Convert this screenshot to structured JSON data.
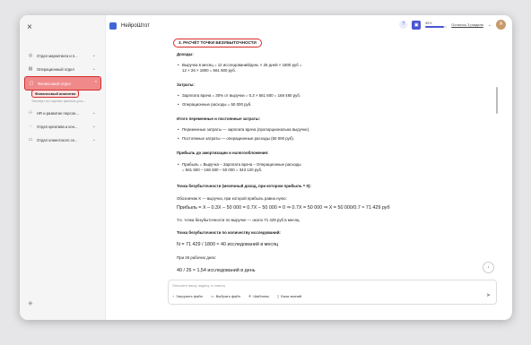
{
  "sidebar": {
    "close": "×",
    "items": [
      {
        "icon": "◎",
        "label": "Отдел маркетинга и п...",
        "chevron": "⌄"
      },
      {
        "icon": "▤",
        "label": "Операционный отдел",
        "chevron": "⌄"
      },
      {
        "icon": "▢",
        "label": "Финансовый отдел",
        "chevron": "^"
      },
      {
        "icon": "⚇",
        "label": "HR и развитие персон...",
        "chevron": "⌄"
      },
      {
        "icon": "◌",
        "label": "Отдел креатива и кон...",
        "chevron": "⌄"
      },
      {
        "icon": "▭",
        "label": "Отдел клиентского се...",
        "chevron": "⌄"
      }
    ],
    "sub_selected": "Финансовый аналитик",
    "sub_dim": "Эксперт по оценке финанс-рис...",
    "bottom_icon": "✳"
  },
  "topbar": {
    "app_name": "НейроШтот",
    "help_icon": "?",
    "square_icon": "▣",
    "percent": "85%",
    "usage_fill": 0.85,
    "remaining": "Осталось 3 раздела",
    "chevron": "⌄",
    "avatar_initial": "A"
  },
  "content": {
    "section_title": "3. РАСЧЁТ ТОЧКИ БЕЗУБЫТОЧНОСТИ",
    "income_h": "Доходы:",
    "income_li1": "Выручка в месяц = 12 исследований/день × 26 дней × 1800 руб =",
    "income_li1b": "12 × 26 × 1800 = 561 600 руб.",
    "costs_h": "Затраты:",
    "costs_li1": "Зарплата врача = 30% от выручки = 0,3 × 561 600 = 168 480 руб.",
    "costs_li2": "Операционные расходы = 50 000 руб.",
    "varfix_h": "Итого переменные и постоянные затраты:",
    "varfix_li1": "Переменные затраты — зарплата врача (пропорциональна выручке).",
    "varfix_li2": "Постоянные затраты — операционные расходы (50 000 руб).",
    "profit_h": "Прибыль до амортизации и налогообложения:",
    "profit_li1": "Прибыль = Выручка – Зарплата врача – Операционные расходы",
    "profit_li1b": "= 561 600 – 168 480 – 50 000 = 343 120 руб.",
    "be_h": "Точка безубыточности (месячный доход, при котором прибыль = 0):",
    "be_t1": "Обозначим X — выручка, при которой прибыль равна нулю:",
    "be_formula": "Прибыль = X – 0.3X – 50 000 = 0.7X – 50 000 = 0 ⇒ 0.7X = 50 000 ⇒ X = 50 000/0.7 ≈ 71 429 руб",
    "be_t2": "Т.е. точка безубыточности по выручке — около 71 429 руб в месяц.",
    "count_h": "Точка безубыточности по количеству исследований:",
    "count_formula": "N = 71 429 / 1800 ≈ 40 исследований в месяц",
    "days_t": "При 26 рабочих днях:",
    "day_formula": "40 / 26 ≈ 1,54 исследований в день"
  },
  "composer": {
    "placeholder": "Опишите вашу задачу, я помогу",
    "attach": "Загрузить файл",
    "pick": "Выбрать файл",
    "templates": "Шаблоны",
    "kb": "База знаний",
    "send_icon": "➤",
    "down_icon": "↓"
  }
}
